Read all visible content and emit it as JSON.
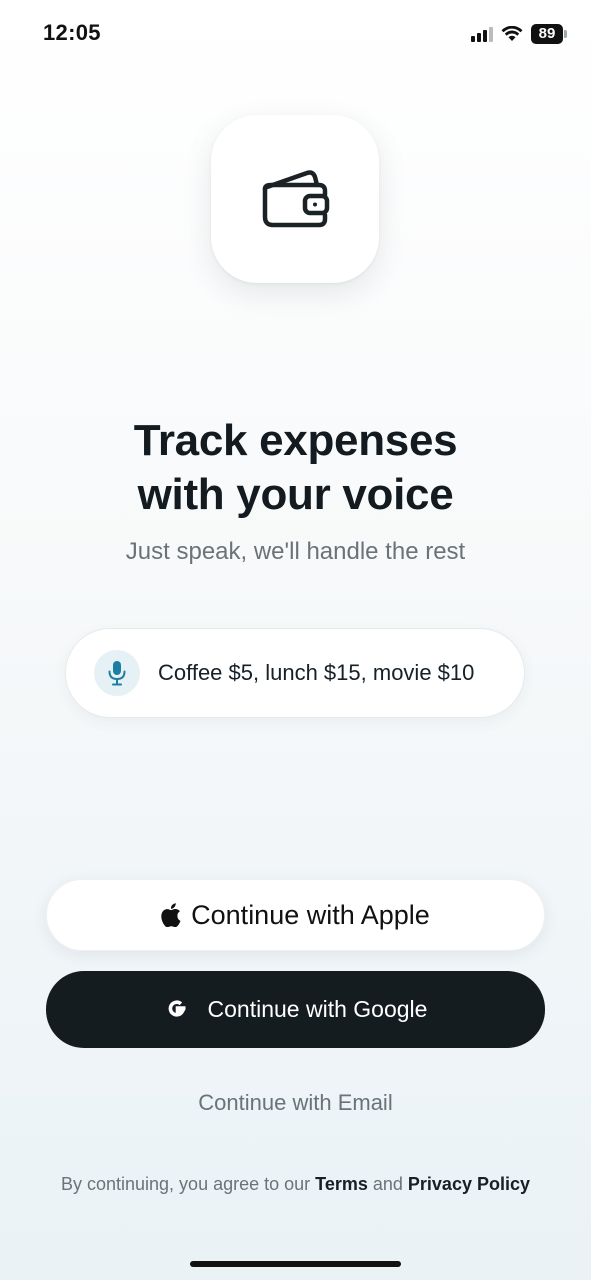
{
  "status_bar": {
    "time": "12:05",
    "battery_level": "89",
    "icons": [
      "cellular-signal-icon",
      "wifi-icon",
      "battery-icon"
    ]
  },
  "app_icon": {
    "icon": "wallet-icon"
  },
  "headline": {
    "line1": "Track expenses",
    "line2": "with your voice"
  },
  "subtitle": "Just speak, we'll handle the rest",
  "voice_example": {
    "icon": "microphone-icon",
    "text": "Coffee $5, lunch $15, movie $10"
  },
  "auth": {
    "apple_label": "Continue with Apple",
    "google_label": "Continue with Google",
    "email_label": "Continue with Email"
  },
  "legal": {
    "prefix": "By continuing, you agree to our ",
    "terms": "Terms",
    "and": " and ",
    "privacy": "Privacy Policy"
  },
  "colors": {
    "dark_button": "#151c20",
    "accent_mic": "#1e7ea1",
    "muted_text": "#6b7378"
  }
}
